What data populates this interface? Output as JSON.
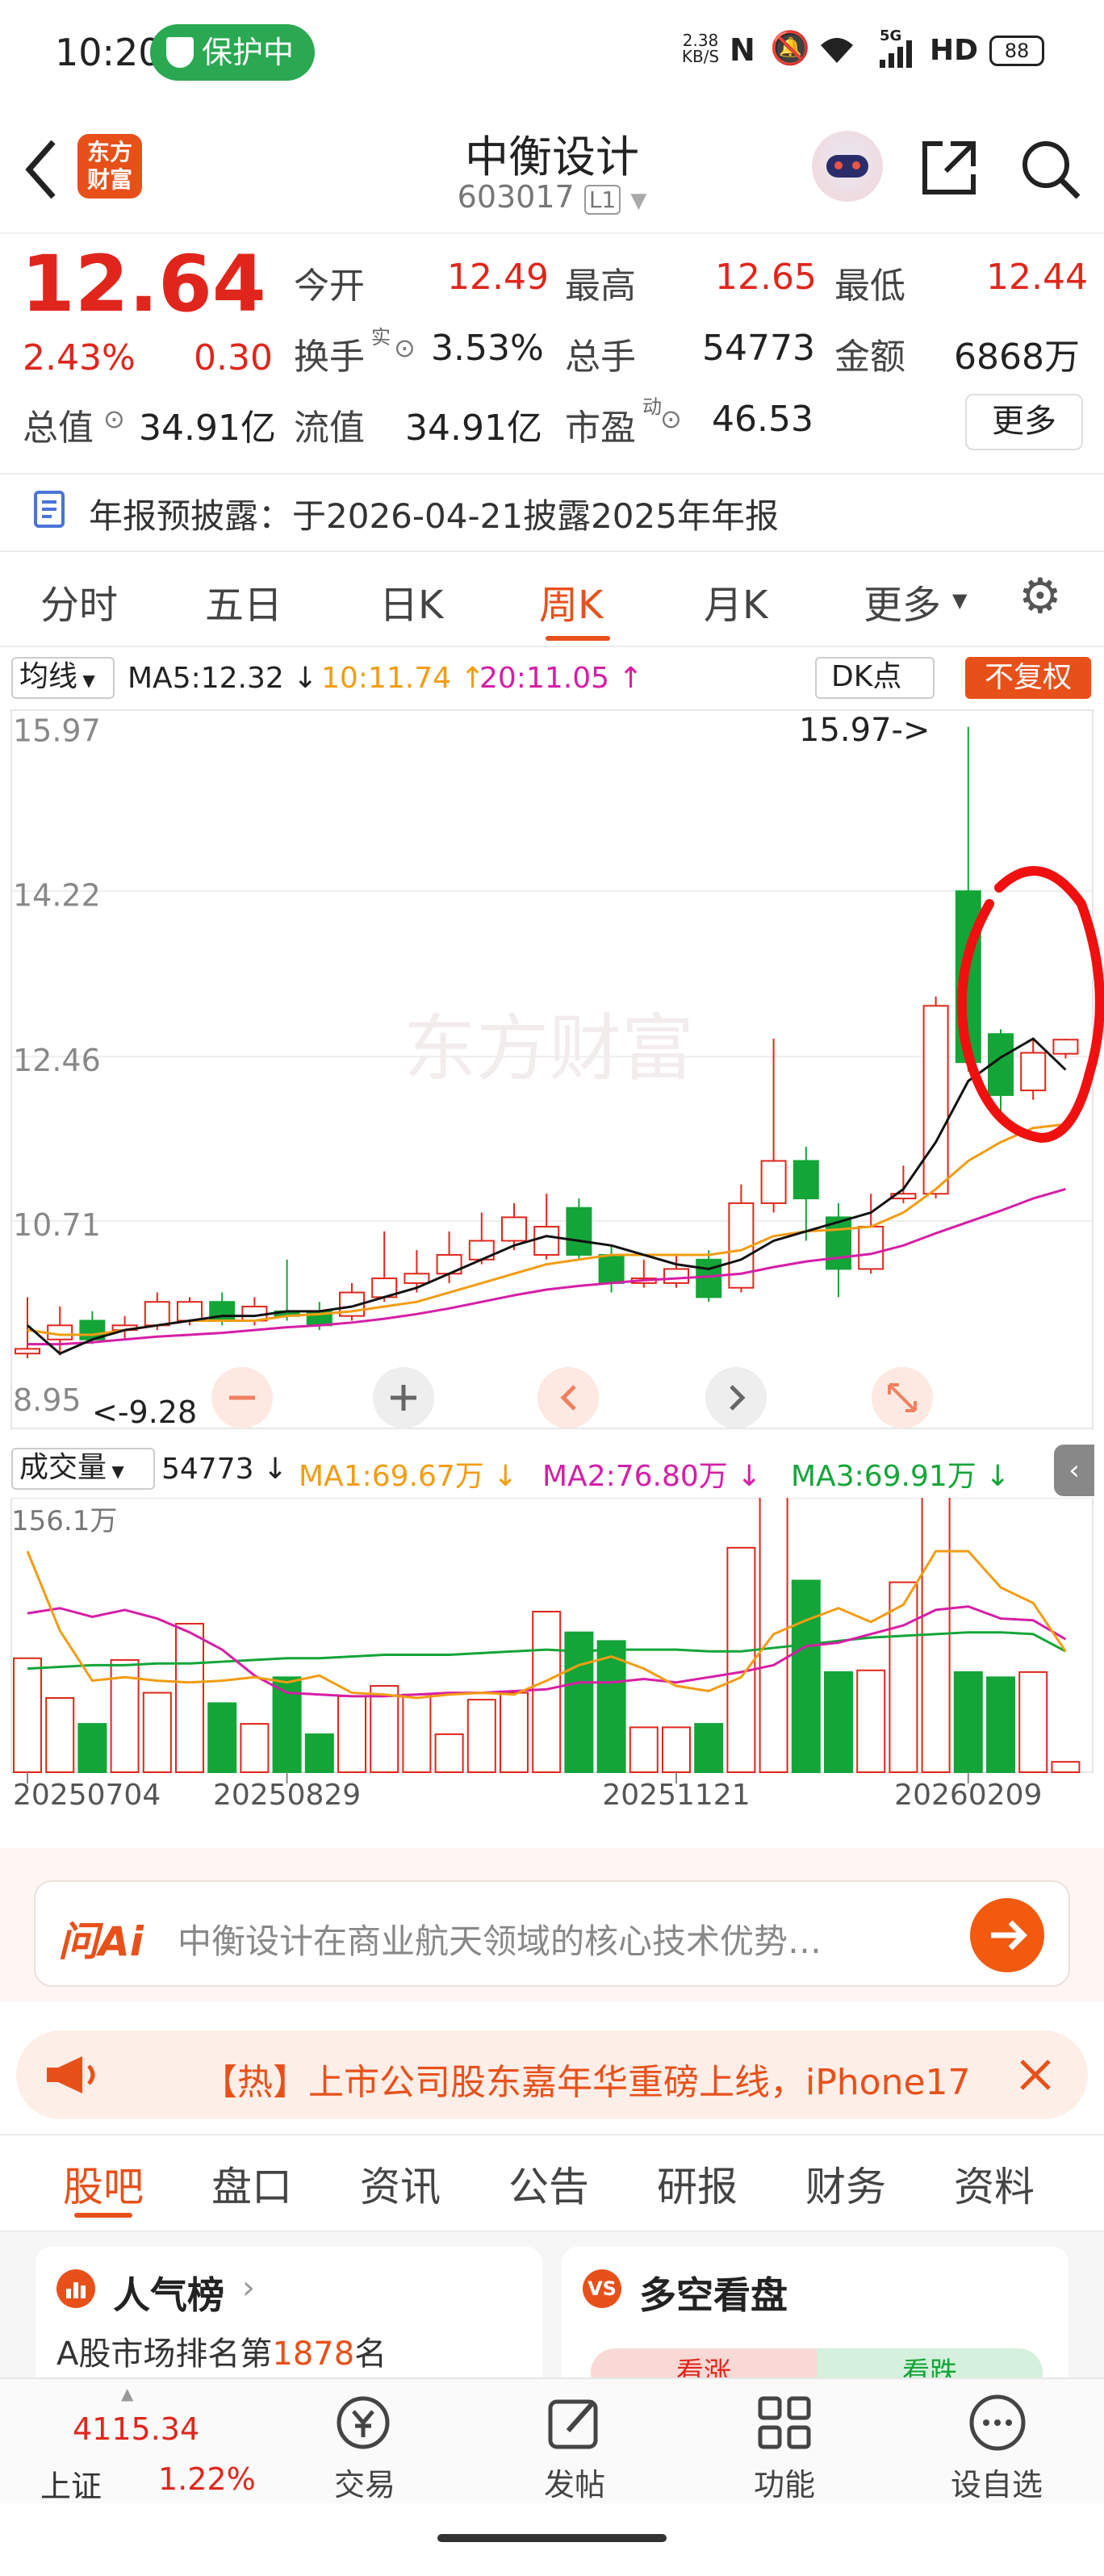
{
  "status": {
    "time": "10:20",
    "protect": "保护中",
    "net_speed_value": "2.38",
    "net_speed_unit": "KB/S",
    "network": "5G",
    "hd": "HD",
    "battery": "88"
  },
  "header": {
    "title": "中衡设计",
    "code": "603017",
    "level": "L1",
    "logo_top": "东方",
    "logo_bottom": "财富"
  },
  "quote": {
    "price": "12.64",
    "change_pct": "2.43%",
    "change": "0.30",
    "open_label": "今开",
    "open": "12.49",
    "high_label": "最高",
    "high": "12.65",
    "low_label": "最低",
    "low": "12.44",
    "turnover_label": "换手",
    "turnover_sup": "实",
    "turnover": "3.53%",
    "volume_label": "总手",
    "volume": "54773",
    "amount_label": "金额",
    "amount": "6868万",
    "mktcap_label": "总值",
    "mktcap": "34.91亿",
    "float_label": "流值",
    "float": "34.91亿",
    "pe_label": "市盈",
    "pe_sup": "动",
    "pe": "46.53",
    "more": "更多"
  },
  "notice": "年报预披露：于2026-04-21披露2025年年报",
  "period_tabs": [
    "分时",
    "五日",
    "日K",
    "周K",
    "月K",
    "更多"
  ],
  "active_tab": "周K",
  "kline_toolbar": {
    "ma_select": "均线",
    "ma5": "MA5:12.32 ↓",
    "ma10": "10:11.74 ↑",
    "ma20": "20:11.05 ↑",
    "dk": "DK点",
    "fq": "不复权"
  },
  "vol_toolbar": {
    "select": "成交量",
    "vol": "54773 ↓",
    "ma1": "MA1:69.67万 ↓",
    "ma2": "MA2:76.80万 ↓",
    "ma3": "MA3:69.91万 ↓"
  },
  "chart_data": {
    "type": "candlestick",
    "y_ticks": [
      "15.97",
      "14.22",
      "12.46",
      "10.71",
      "8.95"
    ],
    "ylim": [
      8.95,
      15.97
    ],
    "annotations": [
      "15.97->",
      "<-9.28"
    ],
    "watermark": "东方财富",
    "dates": [
      "20250704",
      "20250829",
      "20251121",
      "20260209"
    ],
    "candles": [
      {
        "o": 9.3,
        "c": 9.35,
        "h": 9.9,
        "l": 9.25,
        "up": true
      },
      {
        "o": 9.45,
        "c": 9.6,
        "h": 9.8,
        "l": 9.28,
        "up": true
      },
      {
        "o": 9.65,
        "c": 9.45,
        "h": 9.75,
        "l": 9.4,
        "up": false
      },
      {
        "o": 9.55,
        "c": 9.6,
        "h": 9.7,
        "l": 9.45,
        "up": true
      },
      {
        "o": 9.6,
        "c": 9.85,
        "h": 9.95,
        "l": 9.55,
        "up": true
      },
      {
        "o": 9.85,
        "c": 9.65,
        "h": 9.9,
        "l": 9.6,
        "up": true
      },
      {
        "o": 9.85,
        "c": 9.65,
        "h": 9.95,
        "l": 9.6,
        "up": false
      },
      {
        "o": 9.65,
        "c": 9.8,
        "h": 9.9,
        "l": 9.6,
        "up": true
      },
      {
        "o": 9.75,
        "c": 9.7,
        "h": 10.3,
        "l": 9.65,
        "up": false
      },
      {
        "o": 9.75,
        "c": 9.6,
        "h": 9.85,
        "l": 9.55,
        "up": false
      },
      {
        "o": 9.7,
        "c": 9.95,
        "h": 10.05,
        "l": 9.65,
        "up": true
      },
      {
        "o": 9.9,
        "c": 10.1,
        "h": 10.6,
        "l": 9.85,
        "up": true
      },
      {
        "o": 10.05,
        "c": 10.15,
        "h": 10.4,
        "l": 9.95,
        "up": true
      },
      {
        "o": 10.15,
        "c": 10.35,
        "h": 10.6,
        "l": 10.05,
        "up": true
      },
      {
        "o": 10.3,
        "c": 10.5,
        "h": 10.8,
        "l": 10.25,
        "up": true
      },
      {
        "o": 10.5,
        "c": 10.75,
        "h": 10.9,
        "l": 10.4,
        "up": true
      },
      {
        "o": 10.65,
        "c": 10.35,
        "h": 11.0,
        "l": 10.3,
        "up": true
      },
      {
        "o": 10.85,
        "c": 10.35,
        "h": 10.95,
        "l": 10.3,
        "up": false
      },
      {
        "o": 10.35,
        "c": 10.05,
        "h": 10.45,
        "l": 9.95,
        "up": false
      },
      {
        "o": 10.05,
        "c": 10.1,
        "h": 10.3,
        "l": 10.0,
        "up": true
      },
      {
        "o": 10.05,
        "c": 10.2,
        "h": 10.35,
        "l": 10.0,
        "up": true
      },
      {
        "o": 10.3,
        "c": 9.9,
        "h": 10.4,
        "l": 9.85,
        "up": false
      },
      {
        "o": 10.0,
        "c": 10.9,
        "h": 11.1,
        "l": 9.95,
        "up": true
      },
      {
        "o": 10.9,
        "c": 11.35,
        "h": 12.65,
        "l": 10.8,
        "up": true
      },
      {
        "o": 11.35,
        "c": 10.95,
        "h": 11.5,
        "l": 10.5,
        "up": false
      },
      {
        "o": 10.75,
        "c": 10.2,
        "h": 10.9,
        "l": 9.9,
        "up": false
      },
      {
        "o": 10.2,
        "c": 10.65,
        "h": 11.0,
        "l": 10.15,
        "up": true
      },
      {
        "o": 10.95,
        "c": 11.0,
        "h": 11.3,
        "l": 10.9,
        "up": true
      },
      {
        "o": 11.0,
        "c": 13.0,
        "h": 13.1,
        "l": 10.95,
        "up": true
      },
      {
        "o": 14.22,
        "c": 12.4,
        "h": 15.97,
        "l": 12.3,
        "up": false
      },
      {
        "o": 12.7,
        "c": 12.05,
        "h": 12.75,
        "l": 11.8,
        "up": false
      },
      {
        "o": 12.1,
        "c": 12.5,
        "h": 12.65,
        "l": 12.0,
        "up": true
      },
      {
        "o": 12.49,
        "c": 12.64,
        "h": 12.65,
        "l": 12.44,
        "up": true
      }
    ],
    "ma5": [
      9.6,
      9.3,
      9.45,
      9.55,
      9.6,
      9.65,
      9.7,
      9.7,
      9.75,
      9.75,
      9.8,
      9.9,
      10.0,
      10.15,
      10.3,
      10.45,
      10.55,
      10.5,
      10.45,
      10.35,
      10.25,
      10.2,
      10.3,
      10.5,
      10.6,
      10.7,
      10.8,
      11.05,
      11.55,
      12.2,
      12.45,
      12.65,
      12.32
    ],
    "ma10": [
      9.55,
      9.5,
      9.5,
      9.55,
      9.6,
      9.65,
      9.65,
      9.65,
      9.7,
      9.72,
      9.75,
      9.8,
      9.85,
      9.95,
      10.05,
      10.15,
      10.25,
      10.3,
      10.35,
      10.35,
      10.35,
      10.35,
      10.4,
      10.55,
      10.6,
      10.62,
      10.65,
      10.8,
      11.05,
      11.35,
      11.55,
      11.7,
      11.74
    ],
    "ma20": [
      9.4,
      9.4,
      9.42,
      9.45,
      9.48,
      9.5,
      9.52,
      9.55,
      9.58,
      9.6,
      9.63,
      9.67,
      9.72,
      9.78,
      9.85,
      9.92,
      9.98,
      10.02,
      10.05,
      10.08,
      10.1,
      10.12,
      10.15,
      10.22,
      10.28,
      10.32,
      10.36,
      10.45,
      10.58,
      10.7,
      10.82,
      10.95,
      11.05
    ],
    "volume_max_label": "156.1万",
    "volume_max": 156.1,
    "volume": [
      66,
      43,
      28,
      65,
      46,
      86,
      40,
      28,
      55,
      22,
      44,
      50,
      45,
      22,
      42,
      46,
      93,
      81,
      76,
      26,
      26,
      28,
      130,
      181,
      111,
      58,
      59,
      110,
      183,
      58,
      55,
      58,
      6
    ],
    "vol_ma1": [
      128,
      82,
      53,
      55,
      53,
      52,
      53,
      55,
      52,
      56,
      46,
      45,
      43,
      45,
      46,
      45,
      53,
      62,
      67,
      60,
      50,
      47,
      55,
      80,
      88,
      95,
      87,
      97,
      128,
      128,
      107,
      98,
      70
    ],
    "vol_ma2": [
      92,
      95,
      90,
      94,
      89,
      81,
      71,
      56,
      46,
      45,
      44,
      44,
      45,
      46,
      46,
      47,
      48,
      52,
      52,
      54,
      52,
      55,
      58,
      62,
      73,
      75,
      80,
      85,
      94,
      96,
      89,
      88,
      77
    ],
    "vol_ma3": [
      60,
      61,
      62,
      62,
      63,
      63,
      64,
      65,
      66,
      66,
      67,
      68,
      68,
      68,
      69,
      70,
      71,
      70,
      71,
      71,
      71,
      70,
      70,
      72,
      74,
      76,
      78,
      79,
      80,
      81,
      81,
      80,
      70
    ]
  },
  "ai_box": {
    "brand": "问Ai",
    "text": "中衡设计在商业航天领域的核心技术优势…"
  },
  "ticker": {
    "text": "【热】上市公司股东嘉年华重磅上线，iPhone17"
  },
  "section_tabs": [
    "股吧",
    "盘口",
    "资讯",
    "公告",
    "研报",
    "财务",
    "资料"
  ],
  "cards": {
    "popular_title": "人气榜",
    "popular_text_prefix": "A股市场排名第",
    "popular_rank": "1878",
    "popular_text_suffix": "名",
    "bull_title": "多空看盘",
    "bull_up": "看涨",
    "bull_down": "看跌"
  },
  "bottom_bar": {
    "index_value": "4115.34",
    "index_name": "上证",
    "index_pct": "1.22%",
    "trade": "交易",
    "post": "发帖",
    "func": "功能",
    "watch": "设自选"
  }
}
